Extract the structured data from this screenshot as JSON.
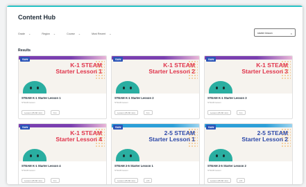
{
  "header": {
    "title": "Content Hub"
  },
  "filters": [
    {
      "label": "Grade"
    },
    {
      "label": "Region"
    },
    {
      "label": "Course"
    },
    {
      "label": "Most Recent"
    }
  ],
  "search": {
    "value": "starter lesson",
    "clear_icon": "close-icon"
  },
  "results_label": "Results",
  "colors": {
    "accent": "#27c3c6",
    "k1_title": "#e0334a",
    "steam25_title": "#2c48a8",
    "badge": "#2c55b8",
    "character": "#2aaea1"
  },
  "cards": [
    {
      "badge": "SAN",
      "thumb_line1": "K-1 STEAM",
      "thumb_line2": "Starter Lesson 1",
      "name": "STEAM K-1 Starter Lesson 1",
      "sub": "STEAM lesson",
      "chip1": "Lesson (45-60 min)",
      "chip2": "K-1",
      "theme": "red"
    },
    {
      "badge": "SAN",
      "thumb_line1": "K-1 STEAM",
      "thumb_line2": "Starter Lesson 2",
      "name": "STEAM K-1 Starter Lesson 2",
      "sub": "STEAM lesson",
      "chip1": "Lesson (45-60 min)",
      "chip2": "K-1",
      "theme": "red"
    },
    {
      "badge": "SAN",
      "thumb_line1": "K-1 STEAM",
      "thumb_line2": "Starter Lesson 3",
      "name": "STEAM K-1 Starter Lesson 3",
      "sub": "STEAM lesson",
      "chip1": "Lesson (45-60 min)",
      "chip2": "K-1",
      "theme": "red"
    },
    {
      "badge": "SAN",
      "thumb_line1": "K-1 STEAM",
      "thumb_line2": "Starter Lesson 4",
      "name": "STEAM K-1 Starter Lesson 4",
      "sub": "STEAM lesson",
      "chip1": "Lesson (45-60 min)",
      "chip2": "K-1",
      "theme": "red"
    },
    {
      "badge": "SAN",
      "thumb_line1": "2-5 STEAM",
      "thumb_line2": "Starter Lesson 1",
      "name": "STEAM 2-5 Starter Lesson 1",
      "sub": "STEAM lesson",
      "chip1": "Lesson (45-60 min)",
      "chip2": "2-5",
      "theme": "blue"
    },
    {
      "badge": "SAN",
      "thumb_line1": "2-5 STEAM",
      "thumb_line2": "Starter Lesson 2",
      "name": "STEAM 2-5 Starter Lesson 2",
      "sub": "STEAM lesson",
      "chip1": "Lesson (45-60 min)",
      "chip2": "2-5",
      "theme": "blue"
    }
  ]
}
